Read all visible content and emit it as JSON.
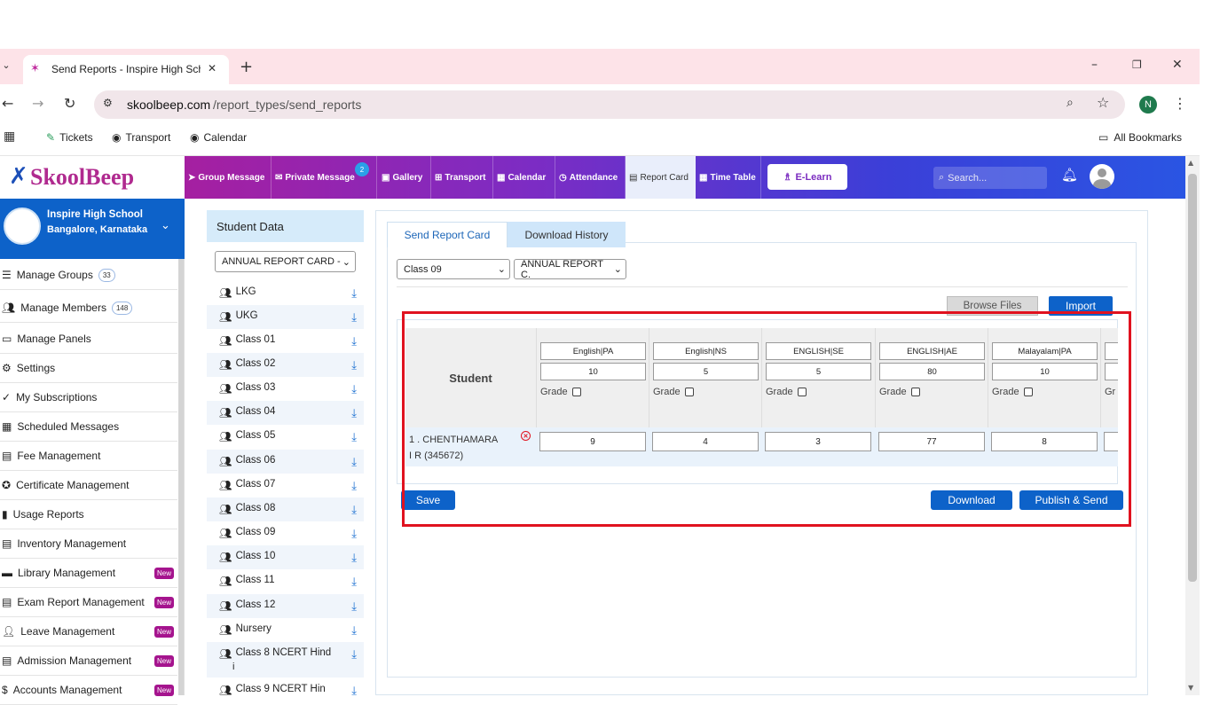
{
  "browser": {
    "tab_title": "Send Reports - Inspire High Sch",
    "url_domain": "skoolbeep.com",
    "url_path": "/report_types/send_reports",
    "profile_initial": "N",
    "bookmarks": [
      "Tickets",
      "Transport",
      "Calendar"
    ],
    "all_bookmarks": "All Bookmarks"
  },
  "app": {
    "logo": "SkoolBeep",
    "nav": [
      {
        "label": "Group Message",
        "icon": "send-icon"
      },
      {
        "label": "Private Message",
        "icon": "envelope-icon",
        "badge": "2"
      },
      {
        "label": "Gallery",
        "icon": "image-icon"
      },
      {
        "label": "Transport",
        "icon": "bus-icon"
      },
      {
        "label": "Calendar",
        "icon": "calendar-icon"
      },
      {
        "label": "Attendance",
        "icon": "clock-icon"
      },
      {
        "label": "Report Card",
        "icon": "document-icon"
      },
      {
        "label": "Time Table",
        "icon": "calendar-icon"
      }
    ],
    "elearn": "E-Learn",
    "search_placeholder": "Search..."
  },
  "sidebar": {
    "school_name": "Inspire High School",
    "school_location": "Bangalore, Karnataka",
    "items": [
      {
        "label": "Manage Groups",
        "count": "33"
      },
      {
        "label": "Manage Members",
        "count": "148"
      },
      {
        "label": "Manage Panels"
      },
      {
        "label": "Settings"
      },
      {
        "label": "My Subscriptions"
      },
      {
        "label": "Scheduled Messages"
      },
      {
        "label": "Fee Management"
      },
      {
        "label": "Certificate Management"
      },
      {
        "label": "Usage Reports"
      },
      {
        "label": "Inventory Management"
      },
      {
        "label": "Library Management",
        "new": "New"
      },
      {
        "label": "Exam Report Management",
        "new": "New"
      },
      {
        "label": "Leave Management",
        "new": "New"
      },
      {
        "label": "Admission Management",
        "new": "New"
      },
      {
        "label": "Accounts Management",
        "new": "New"
      }
    ]
  },
  "student_data": {
    "title": "Student Data",
    "report_select": "ANNUAL REPORT CARD -",
    "classes": [
      "LKG",
      "UKG",
      "Class 01",
      "Class 02",
      "Class 03",
      "Class 04",
      "Class 05",
      "Class 06",
      "Class 07",
      "Class 08",
      "Class 09",
      "Class 10",
      "Class 11",
      "Class 12",
      "Nursery",
      "Class 8 NCERT Hind",
      "Class 9 NCERT Hin"
    ],
    "class_wrap": "i"
  },
  "main": {
    "tabs": [
      "Send Report Card",
      "Download History"
    ],
    "class_select": "Class 09",
    "report_select": "ANNUAL REPORT C.",
    "browse": "Browse Files",
    "import": "Import",
    "student_header": "Student",
    "grade_label": "Grade",
    "columns": [
      {
        "subject": "English|PA",
        "max": "10",
        "value": "9"
      },
      {
        "subject": "English|NS",
        "max": "5",
        "value": "4"
      },
      {
        "subject": "ENGLISH|SE",
        "max": "5",
        "value": "3"
      },
      {
        "subject": "ENGLISH|AE",
        "max": "80",
        "value": "77"
      },
      {
        "subject": "Malayalam|PA",
        "max": "10",
        "value": "8"
      }
    ],
    "partial_grade": "Gr",
    "student_line1": "1 . CHENTHAMARA",
    "student_line2": "I R (345672)",
    "save": "Save",
    "download": "Download",
    "publish": "Publish & Send"
  }
}
